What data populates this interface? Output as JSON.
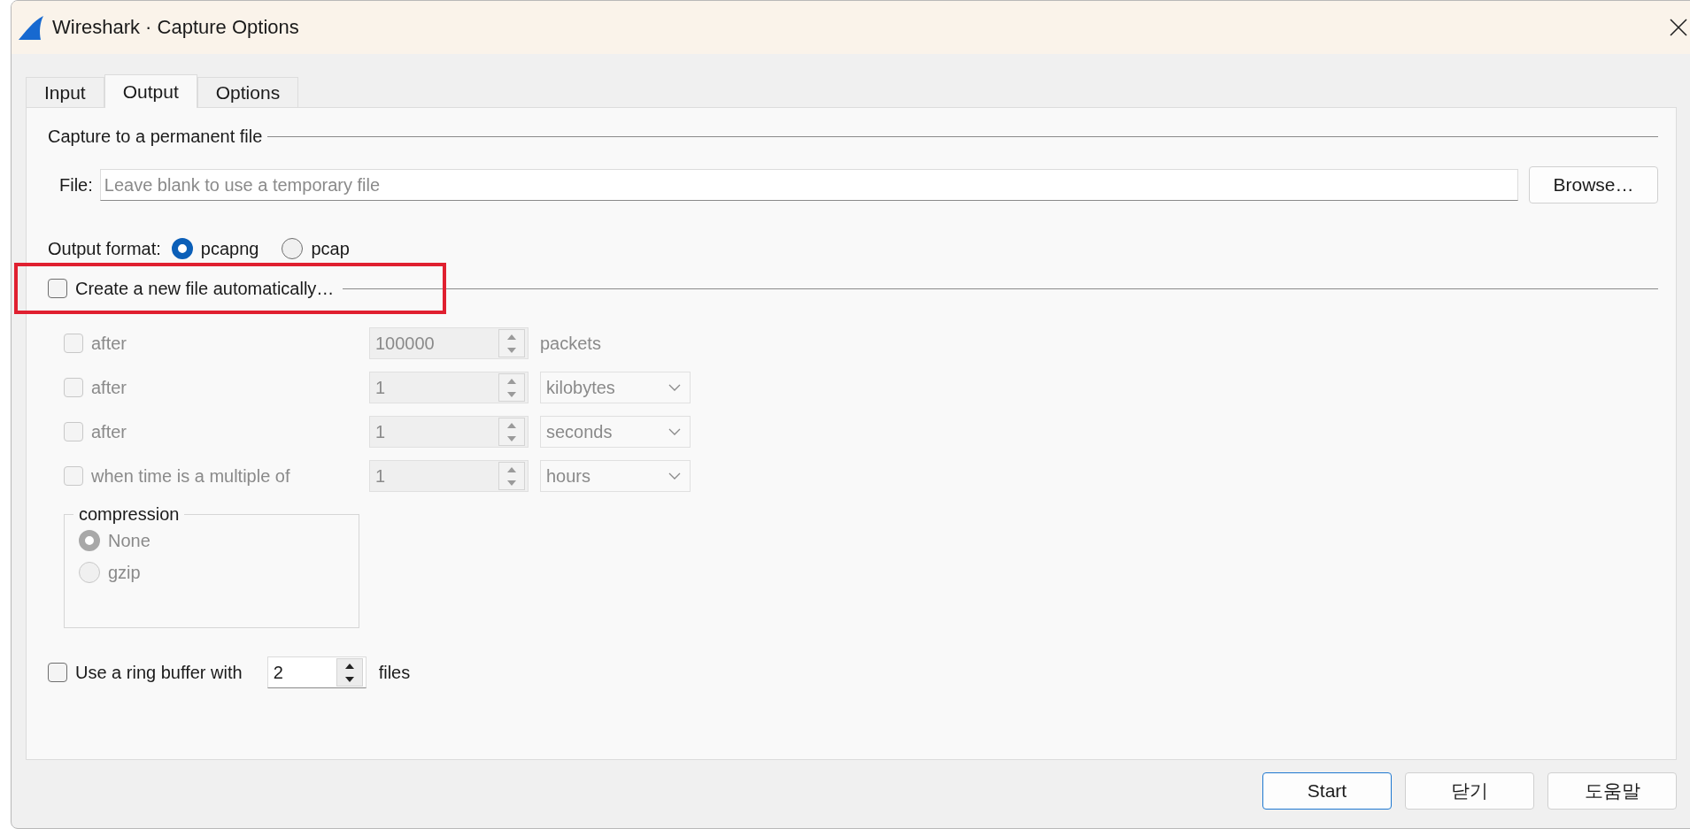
{
  "window": {
    "title": "Wireshark · Capture Options"
  },
  "tabs": [
    {
      "label": "Input",
      "selected": false
    },
    {
      "label": "Output",
      "selected": true
    },
    {
      "label": "Options",
      "selected": false
    }
  ],
  "permanent_file": {
    "heading": "Capture to a permanent file",
    "file_label": "File:",
    "file_placeholder": "Leave blank to use a temporary file",
    "browse_button": "Browse…"
  },
  "output_format": {
    "label": "Output format:",
    "options": [
      {
        "label": "pcapng",
        "selected": true
      },
      {
        "label": "pcap",
        "selected": false
      }
    ]
  },
  "auto_file": {
    "label": "Create a new file automatically…",
    "checked": false,
    "highlighted": true,
    "conditions": [
      {
        "label": "after",
        "checked": false,
        "disabled": true,
        "value": "100000",
        "unit": {
          "kind": "text",
          "label": "packets"
        }
      },
      {
        "label": "after",
        "checked": false,
        "disabled": true,
        "value": "1",
        "unit": {
          "kind": "dropdown",
          "label": "kilobytes"
        }
      },
      {
        "label": "after",
        "checked": false,
        "disabled": true,
        "value": "1",
        "unit": {
          "kind": "dropdown",
          "label": "seconds"
        }
      },
      {
        "label": "when time is a multiple of",
        "checked": false,
        "disabled": true,
        "value": "1",
        "unit": {
          "kind": "dropdown",
          "label": "hours"
        }
      }
    ],
    "compression": {
      "title": "compression",
      "disabled": true,
      "options": [
        {
          "label": "None",
          "selected": true
        },
        {
          "label": "gzip",
          "selected": false
        }
      ]
    }
  },
  "ring_buffer": {
    "label": "Use a ring buffer with",
    "checked": false,
    "value": "2",
    "suffix": "files"
  },
  "buttons": [
    {
      "label": "Start",
      "default": true
    },
    {
      "label": "닫기",
      "default": false
    },
    {
      "label": "도움말",
      "default": false
    }
  ]
}
